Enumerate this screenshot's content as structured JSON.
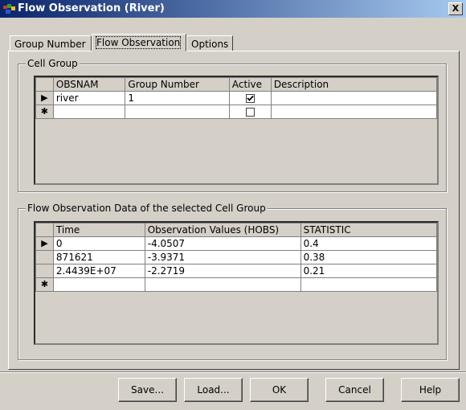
{
  "window": {
    "title": "Flow Observation (River)",
    "close_label": "X"
  },
  "tabs": [
    {
      "label": "Group Number"
    },
    {
      "label": "Flow Observation"
    },
    {
      "label": "Options"
    }
  ],
  "cell_group": {
    "label": "Cell Group",
    "columns": [
      "OBSNAM",
      "Group Number",
      "Active",
      "Description"
    ],
    "rows": [
      {
        "indicator": "▶",
        "obsnam": "river",
        "group_number": "1",
        "active": true,
        "description": ""
      },
      {
        "indicator": "✱",
        "obsnam": "",
        "group_number": "",
        "active": false,
        "description": ""
      }
    ]
  },
  "flow_data": {
    "label": "Flow Observation Data of the selected Cell Group",
    "columns": [
      "Time",
      "Observation Values (HOBS)",
      "STATISTIC"
    ],
    "rows": [
      {
        "indicator": "▶",
        "time": "0",
        "hobs": "-4.0507",
        "statistic": "0.4"
      },
      {
        "indicator": "",
        "time": "871621",
        "hobs": "-3.9371",
        "statistic": "0.38"
      },
      {
        "indicator": "",
        "time": "2.4439E+07",
        "hobs": "-2.2719",
        "statistic": "0.21"
      },
      {
        "indicator": "✱",
        "time": "",
        "hobs": "",
        "statistic": ""
      }
    ]
  },
  "buttons": {
    "save": "Save...",
    "load": "Load...",
    "ok": "OK",
    "cancel": "Cancel",
    "help": "Help"
  }
}
